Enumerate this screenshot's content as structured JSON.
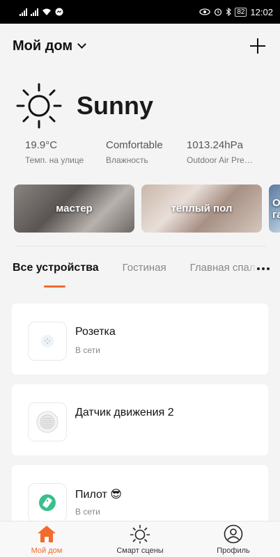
{
  "statusbar": {
    "battery": "82",
    "time": "12:02"
  },
  "header": {
    "home_name": "Мой дом"
  },
  "weather": {
    "condition": "Sunny",
    "stats": [
      {
        "value": "19.9°C",
        "label": "Темп. на улице"
      },
      {
        "value": "Comfortable",
        "label": "Влажность"
      },
      {
        "value": "1013.24hPa",
        "label": "Outdoor Air Pressure"
      }
    ]
  },
  "scenes": [
    {
      "label": "мастер"
    },
    {
      "label": "тёплый пол"
    },
    {
      "label": "Ок га"
    }
  ],
  "tabs": [
    {
      "label": "Все устройства",
      "active": true
    },
    {
      "label": "Гостиная"
    },
    {
      "label": "Главная спальня"
    }
  ],
  "devices": [
    {
      "name": "Розетка",
      "status": "В сети"
    },
    {
      "name": "Датчик движения 2",
      "status": ""
    },
    {
      "name": "Пилот 😎",
      "status": "В сети"
    }
  ],
  "nav": [
    {
      "label": "Мой дом",
      "active": true
    },
    {
      "label": "Смарт сцены"
    },
    {
      "label": "Профиль"
    }
  ],
  "colors": {
    "accent": "#f26b2c",
    "background": "#f4f4f4"
  }
}
